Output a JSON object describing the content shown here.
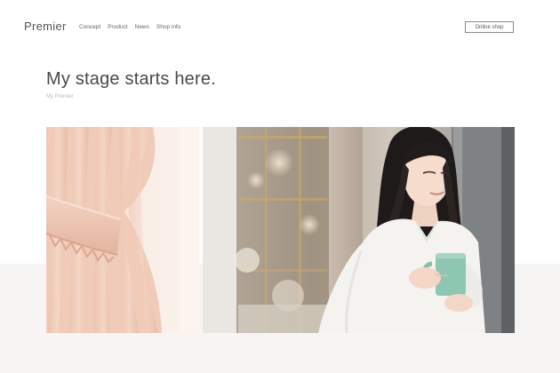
{
  "header": {
    "logo": "Premier",
    "nav": [
      "Concept",
      "Product",
      "News",
      "Shop info"
    ],
    "shop_button": "Online shop"
  },
  "hero": {
    "headline": "My stage starts here.",
    "subheadline": "My Premier"
  },
  "images": [
    {
      "subject": "curtain-tieback-photo"
    },
    {
      "subject": "woman-holding-mug-photo"
    }
  ],
  "colors": {
    "background": "#ffffff",
    "lower_band": "#f7f5f3",
    "headline_text": "#4a4a4a",
    "subheadline_text": "#c8b6b0",
    "curtain": "#f2d2c2",
    "mug": "#8ec7b1"
  }
}
